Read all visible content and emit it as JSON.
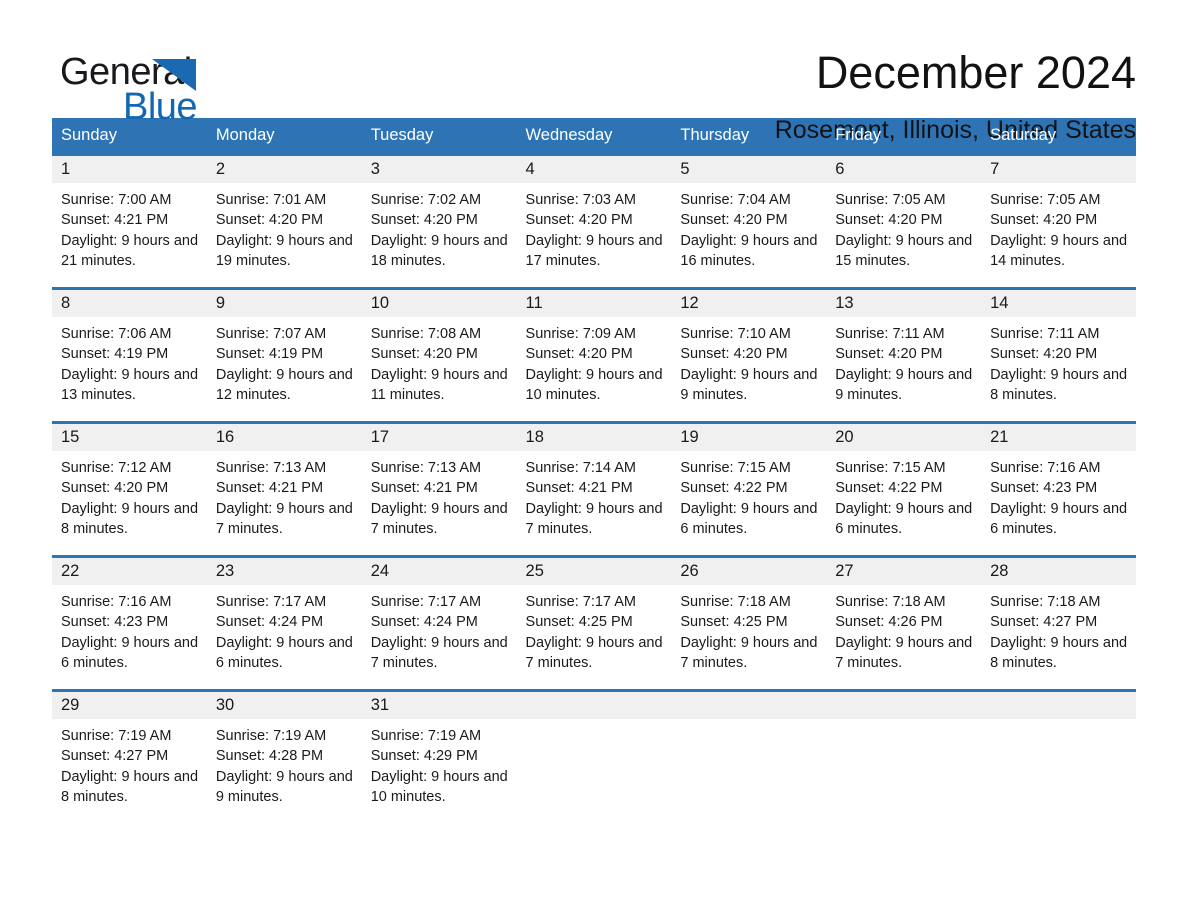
{
  "brand": {
    "name_part1": "General",
    "name_part2": "Blue",
    "triangle_color": "#1b69b0",
    "blue_text_color": "#1267b4"
  },
  "header": {
    "month_title": "December 2024",
    "location": "Rosemont, Illinois, United States"
  },
  "theme": {
    "header_blue": "#2e74b5",
    "daynum_band_gray": "#f0f0f0",
    "page_background": "#ffffff",
    "text_color": "#1a1a1a"
  },
  "calendar": {
    "weekday_headers": [
      "Sunday",
      "Monday",
      "Tuesday",
      "Wednesday",
      "Thursday",
      "Friday",
      "Saturday"
    ],
    "weeks": [
      [
        {
          "day": "1",
          "sunrise": "Sunrise: 7:00 AM",
          "sunset": "Sunset: 4:21 PM",
          "daylight": "Daylight: 9 hours and 21 minutes."
        },
        {
          "day": "2",
          "sunrise": "Sunrise: 7:01 AM",
          "sunset": "Sunset: 4:20 PM",
          "daylight": "Daylight: 9 hours and 19 minutes."
        },
        {
          "day": "3",
          "sunrise": "Sunrise: 7:02 AM",
          "sunset": "Sunset: 4:20 PM",
          "daylight": "Daylight: 9 hours and 18 minutes."
        },
        {
          "day": "4",
          "sunrise": "Sunrise: 7:03 AM",
          "sunset": "Sunset: 4:20 PM",
          "daylight": "Daylight: 9 hours and 17 minutes."
        },
        {
          "day": "5",
          "sunrise": "Sunrise: 7:04 AM",
          "sunset": "Sunset: 4:20 PM",
          "daylight": "Daylight: 9 hours and 16 minutes."
        },
        {
          "day": "6",
          "sunrise": "Sunrise: 7:05 AM",
          "sunset": "Sunset: 4:20 PM",
          "daylight": "Daylight: 9 hours and 15 minutes."
        },
        {
          "day": "7",
          "sunrise": "Sunrise: 7:05 AM",
          "sunset": "Sunset: 4:20 PM",
          "daylight": "Daylight: 9 hours and 14 minutes."
        }
      ],
      [
        {
          "day": "8",
          "sunrise": "Sunrise: 7:06 AM",
          "sunset": "Sunset: 4:19 PM",
          "daylight": "Daylight: 9 hours and 13 minutes."
        },
        {
          "day": "9",
          "sunrise": "Sunrise: 7:07 AM",
          "sunset": "Sunset: 4:19 PM",
          "daylight": "Daylight: 9 hours and 12 minutes."
        },
        {
          "day": "10",
          "sunrise": "Sunrise: 7:08 AM",
          "sunset": "Sunset: 4:20 PM",
          "daylight": "Daylight: 9 hours and 11 minutes."
        },
        {
          "day": "11",
          "sunrise": "Sunrise: 7:09 AM",
          "sunset": "Sunset: 4:20 PM",
          "daylight": "Daylight: 9 hours and 10 minutes."
        },
        {
          "day": "12",
          "sunrise": "Sunrise: 7:10 AM",
          "sunset": "Sunset: 4:20 PM",
          "daylight": "Daylight: 9 hours and 9 minutes."
        },
        {
          "day": "13",
          "sunrise": "Sunrise: 7:11 AM",
          "sunset": "Sunset: 4:20 PM",
          "daylight": "Daylight: 9 hours and 9 minutes."
        },
        {
          "day": "14",
          "sunrise": "Sunrise: 7:11 AM",
          "sunset": "Sunset: 4:20 PM",
          "daylight": "Daylight: 9 hours and 8 minutes."
        }
      ],
      [
        {
          "day": "15",
          "sunrise": "Sunrise: 7:12 AM",
          "sunset": "Sunset: 4:20 PM",
          "daylight": "Daylight: 9 hours and 8 minutes."
        },
        {
          "day": "16",
          "sunrise": "Sunrise: 7:13 AM",
          "sunset": "Sunset: 4:21 PM",
          "daylight": "Daylight: 9 hours and 7 minutes."
        },
        {
          "day": "17",
          "sunrise": "Sunrise: 7:13 AM",
          "sunset": "Sunset: 4:21 PM",
          "daylight": "Daylight: 9 hours and 7 minutes."
        },
        {
          "day": "18",
          "sunrise": "Sunrise: 7:14 AM",
          "sunset": "Sunset: 4:21 PM",
          "daylight": "Daylight: 9 hours and 7 minutes."
        },
        {
          "day": "19",
          "sunrise": "Sunrise: 7:15 AM",
          "sunset": "Sunset: 4:22 PM",
          "daylight": "Daylight: 9 hours and 6 minutes."
        },
        {
          "day": "20",
          "sunrise": "Sunrise: 7:15 AM",
          "sunset": "Sunset: 4:22 PM",
          "daylight": "Daylight: 9 hours and 6 minutes."
        },
        {
          "day": "21",
          "sunrise": "Sunrise: 7:16 AM",
          "sunset": "Sunset: 4:23 PM",
          "daylight": "Daylight: 9 hours and 6 minutes."
        }
      ],
      [
        {
          "day": "22",
          "sunrise": "Sunrise: 7:16 AM",
          "sunset": "Sunset: 4:23 PM",
          "daylight": "Daylight: 9 hours and 6 minutes."
        },
        {
          "day": "23",
          "sunrise": "Sunrise: 7:17 AM",
          "sunset": "Sunset: 4:24 PM",
          "daylight": "Daylight: 9 hours and 6 minutes."
        },
        {
          "day": "24",
          "sunrise": "Sunrise: 7:17 AM",
          "sunset": "Sunset: 4:24 PM",
          "daylight": "Daylight: 9 hours and 7 minutes."
        },
        {
          "day": "25",
          "sunrise": "Sunrise: 7:17 AM",
          "sunset": "Sunset: 4:25 PM",
          "daylight": "Daylight: 9 hours and 7 minutes."
        },
        {
          "day": "26",
          "sunrise": "Sunrise: 7:18 AM",
          "sunset": "Sunset: 4:25 PM",
          "daylight": "Daylight: 9 hours and 7 minutes."
        },
        {
          "day": "27",
          "sunrise": "Sunrise: 7:18 AM",
          "sunset": "Sunset: 4:26 PM",
          "daylight": "Daylight: 9 hours and 7 minutes."
        },
        {
          "day": "28",
          "sunrise": "Sunrise: 7:18 AM",
          "sunset": "Sunset: 4:27 PM",
          "daylight": "Daylight: 9 hours and 8 minutes."
        }
      ],
      [
        {
          "day": "29",
          "sunrise": "Sunrise: 7:19 AM",
          "sunset": "Sunset: 4:27 PM",
          "daylight": "Daylight: 9 hours and 8 minutes."
        },
        {
          "day": "30",
          "sunrise": "Sunrise: 7:19 AM",
          "sunset": "Sunset: 4:28 PM",
          "daylight": "Daylight: 9 hours and 9 minutes."
        },
        {
          "day": "31",
          "sunrise": "Sunrise: 7:19 AM",
          "sunset": "Sunset: 4:29 PM",
          "daylight": "Daylight: 9 hours and 10 minutes."
        },
        {
          "day": "",
          "sunrise": "",
          "sunset": "",
          "daylight": ""
        },
        {
          "day": "",
          "sunrise": "",
          "sunset": "",
          "daylight": ""
        },
        {
          "day": "",
          "sunrise": "",
          "sunset": "",
          "daylight": ""
        },
        {
          "day": "",
          "sunrise": "",
          "sunset": "",
          "daylight": ""
        }
      ]
    ]
  }
}
